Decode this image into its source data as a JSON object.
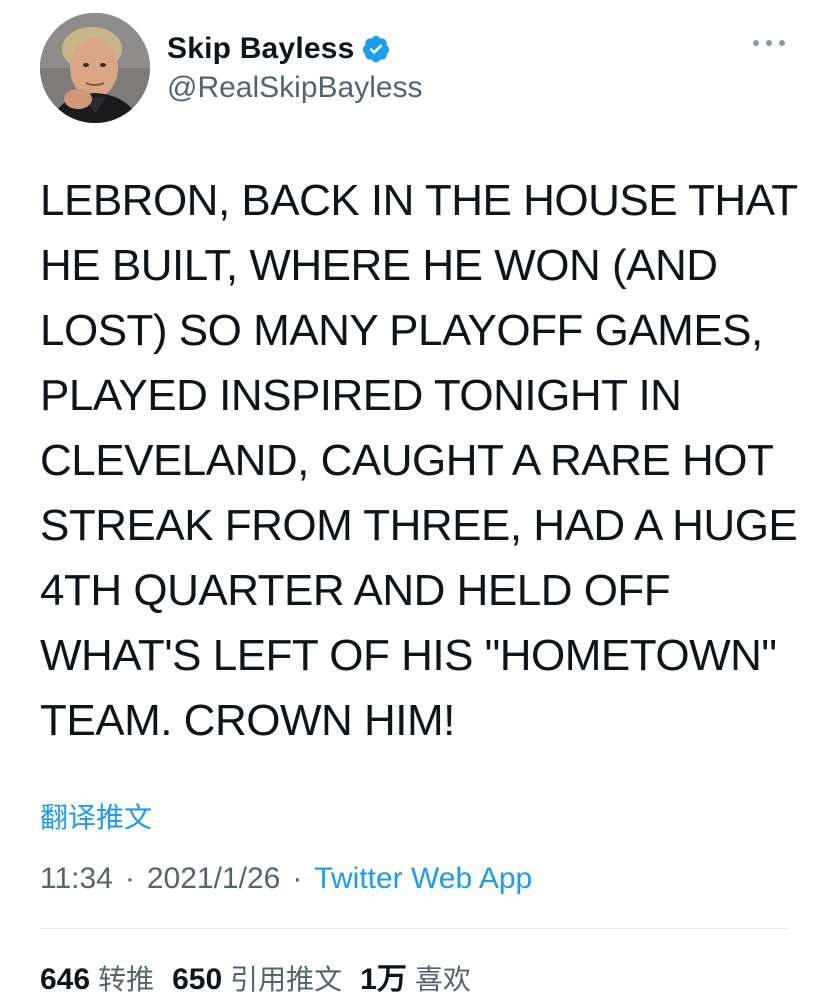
{
  "author": {
    "display_name": "Skip Bayless",
    "handle": "@RealSkipBayless",
    "verified": true
  },
  "tweet": {
    "text": "LEBRON, BACK IN THE HOUSE THAT\nHE BUILT, WHERE HE WON (AND\nLOST) SO MANY PLAYOFF GAMES,\nPLAYED INSPIRED TONIGHT IN\nCLEVELAND, CAUGHT A RARE HOT\nSTREAK FROM THREE, HAD A HUGE\n4TH QUARTER AND HELD OFF\nWHAT'S LEFT OF HIS \"HOMETOWN\"\nTEAM. CROWN HIM!",
    "translate_label": "翻译推文",
    "time": "11:34",
    "date": "2021/1/26",
    "separator": "·",
    "source": "Twitter Web App"
  },
  "stats": {
    "retweets_count": "646",
    "retweets_label": "转推",
    "quotes_count": "650",
    "quotes_label": "引用推文",
    "likes_count": "1万",
    "likes_label": "喜欢"
  },
  "colors": {
    "accent": "#1d9bf0",
    "secondary_text": "#536471",
    "primary_text": "#0f1419"
  },
  "icons": {
    "verified": "verified-badge-icon",
    "more": "more-options-icon"
  }
}
